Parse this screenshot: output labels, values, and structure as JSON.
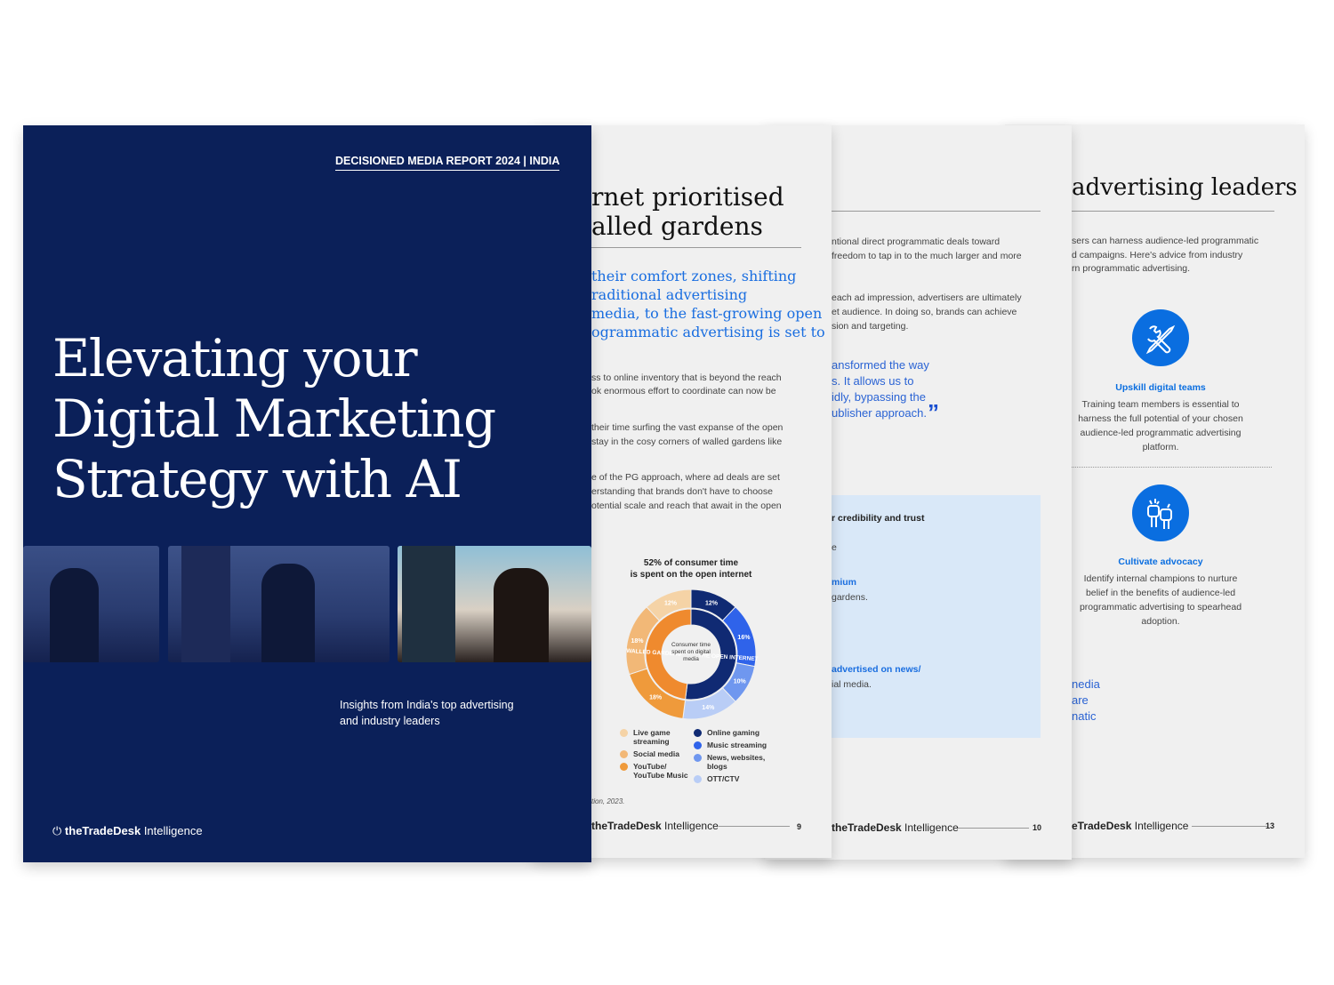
{
  "cover": {
    "report_label": "DECISIONED MEDIA REPORT 2024 | INDIA",
    "title_lines": [
      "Elevating your",
      "Digital Marketing",
      "Strategy with AI"
    ],
    "subtitle_lines": [
      "Insights from India's top advertising",
      "and industry leaders"
    ],
    "brand": "theTradeDesk",
    "brand_suffix": "Intelligence",
    "bg_color": "#0b2059"
  },
  "page9": {
    "heading_lines": [
      "rnet prioritised",
      "alled gardens"
    ],
    "quote_lines": [
      "their comfort zones, shifting",
      "raditional advertising",
      "media, to the fast-growing open",
      "ogrammatic advertising is set to"
    ],
    "body_lines": [
      "ss to online inventory that is beyond the reach",
      "ok enormous effort to coordinate can now be",
      "their time surfing the vast expanse of the open",
      "stay in the cosy corners of walled gardens like",
      "e of the PG approach, where ad deals are set",
      "erstanding that brands don't have to choose",
      "otential scale and reach that await in the open"
    ],
    "source": "tion, 2023.",
    "brand": "theTradeDesk",
    "brand_suffix": "Intelligence",
    "page_number": "9"
  },
  "page10": {
    "body_lines": [
      "ntional direct programmatic deals toward",
      "freedom to tap in to the much larger and more",
      "each ad impression, advertisers are ultimately",
      "et audience. In doing so, brands can achieve",
      "sion and targeting."
    ],
    "quote_lines": [
      "ansformed the way",
      "s. It allows us to",
      "idly, bypassing the",
      "ublisher approach."
    ],
    "box": {
      "heading": "r credibility and trust",
      "line1": "e",
      "highlight1": "mium",
      "line2": "gardens.",
      "highlight2": "advertised on news/",
      "line3": "ial media."
    },
    "brand": "theTradeDesk",
    "brand_suffix": "Intelligence",
    "page_number": "10"
  },
  "page13": {
    "heading": "advertising leaders",
    "intro_lines": [
      "sers can harness audience-led programmatic",
      "d campaigns. Here's advice from industry",
      "rn programmatic advertising."
    ],
    "tips": [
      {
        "icon": "wrench-pencil-icon",
        "title": "Upskill digital teams",
        "lines": [
          "Training team members is essential to",
          "harness the full potential of your chosen",
          "audience-led programmatic advertising",
          "platform."
        ]
      },
      {
        "icon": "raised-fists-icon",
        "title": "Cultivate advocacy",
        "lines": [
          "Identify internal champions to nurture",
          "belief in the benefits of audience-led",
          "programmatic advertising to spearhead",
          "adoption."
        ]
      }
    ],
    "quote_lines": [
      "nedia",
      "are",
      "natic"
    ],
    "brand": "eTradeDesk",
    "brand_suffix": "Intelligence",
    "page_number": "13"
  },
  "chart_data": {
    "type": "pie",
    "title": "52% of consumer time is spent on the open internet",
    "title_lines": [
      "52% of consumer time",
      "is spent on the open internet"
    ],
    "center_label_lines": [
      "Consumer time",
      "spent on digital",
      "media"
    ],
    "inner_ring": [
      {
        "name": "THE OPEN INTERNET",
        "value": 52,
        "color": "#102a73"
      },
      {
        "name": "WALLED GARDENS",
        "value": 48,
        "color": "#ef8a2e"
      }
    ],
    "outer_ring": [
      {
        "name": "Online gaming",
        "value": 12,
        "label": "12%",
        "color": "#102a73"
      },
      {
        "name": "Music streaming",
        "value": 16,
        "label": "16%",
        "color": "#2f63ea"
      },
      {
        "name": "News, websites, blogs",
        "value": 10,
        "label": "10%",
        "color": "#6f97ef"
      },
      {
        "name": "OTT/CTV",
        "value": 14,
        "label": "14%",
        "color": "#b9cdf6"
      },
      {
        "name": "YouTube/ YouTube Music",
        "value": 18,
        "label": "18%",
        "color": "#ef9a3b"
      },
      {
        "name": "Social media",
        "value": 18,
        "label": "18%",
        "color": "#f2b877"
      },
      {
        "name": "Live game streaming",
        "value": 12,
        "label": "12%",
        "color": "#f5d3a6"
      }
    ],
    "legend_left": [
      {
        "label": "Live game streaming",
        "lines": [
          "Live game",
          "streaming"
        ],
        "color": "#f5d3a6"
      },
      {
        "label": "Social media",
        "lines": [
          "Social media"
        ],
        "color": "#f2b877"
      },
      {
        "label": "YouTube/ YouTube Music",
        "lines": [
          "YouTube/",
          "YouTube Music"
        ],
        "color": "#ef9a3b"
      }
    ],
    "legend_right": [
      {
        "label": "Online gaming",
        "lines": [
          "Online gaming"
        ],
        "color": "#102a73"
      },
      {
        "label": "Music streaming",
        "lines": [
          "Music streaming"
        ],
        "color": "#2f63ea"
      },
      {
        "label": "News, websites, blogs",
        "lines": [
          "News, websites,",
          "blogs"
        ],
        "color": "#6f97ef"
      },
      {
        "label": "OTT/CTV",
        "lines": [
          "OTT/CTV"
        ],
        "color": "#b9cdf6"
      }
    ]
  }
}
